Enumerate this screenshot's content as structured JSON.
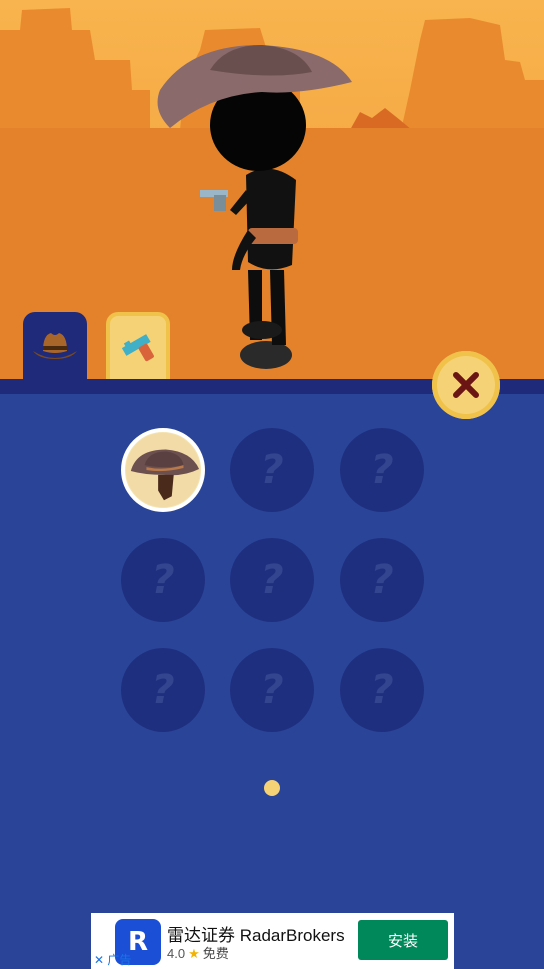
{
  "scene": {
    "alt": "character-preview"
  },
  "tabs": [
    {
      "name": "hats",
      "icon": "cowboy-hat-icon",
      "selected": true
    },
    {
      "name": "guns",
      "icon": "revolver-icon",
      "selected": false
    }
  ],
  "close": {
    "icon": "close-icon"
  },
  "grid": {
    "slots": [
      {
        "state": "owned",
        "icon": "wide-brim-hat-icon"
      },
      {
        "state": "locked",
        "mark": "?"
      },
      {
        "state": "locked",
        "mark": "?"
      },
      {
        "state": "locked",
        "mark": "?"
      },
      {
        "state": "locked",
        "mark": "?"
      },
      {
        "state": "locked",
        "mark": "?"
      },
      {
        "state": "locked",
        "mark": "?"
      },
      {
        "state": "locked",
        "mark": "?"
      },
      {
        "state": "locked",
        "mark": "?"
      }
    ]
  },
  "pager": {
    "page": 1,
    "pages": 1
  },
  "ad": {
    "logo_text": "R",
    "title": "雷达证券 RadarBrokers",
    "rating": "4.0",
    "star": "★",
    "price": "免费",
    "install_label": "安装",
    "close_label": "✕ 广告"
  },
  "colors": {
    "sky_top": "#f6b24c",
    "sky_bottom": "#e88a2c",
    "panel": "#2a4598",
    "slot_locked": "#1f2f80",
    "accent_yellow": "#f6d276",
    "install_green": "#00875a"
  }
}
